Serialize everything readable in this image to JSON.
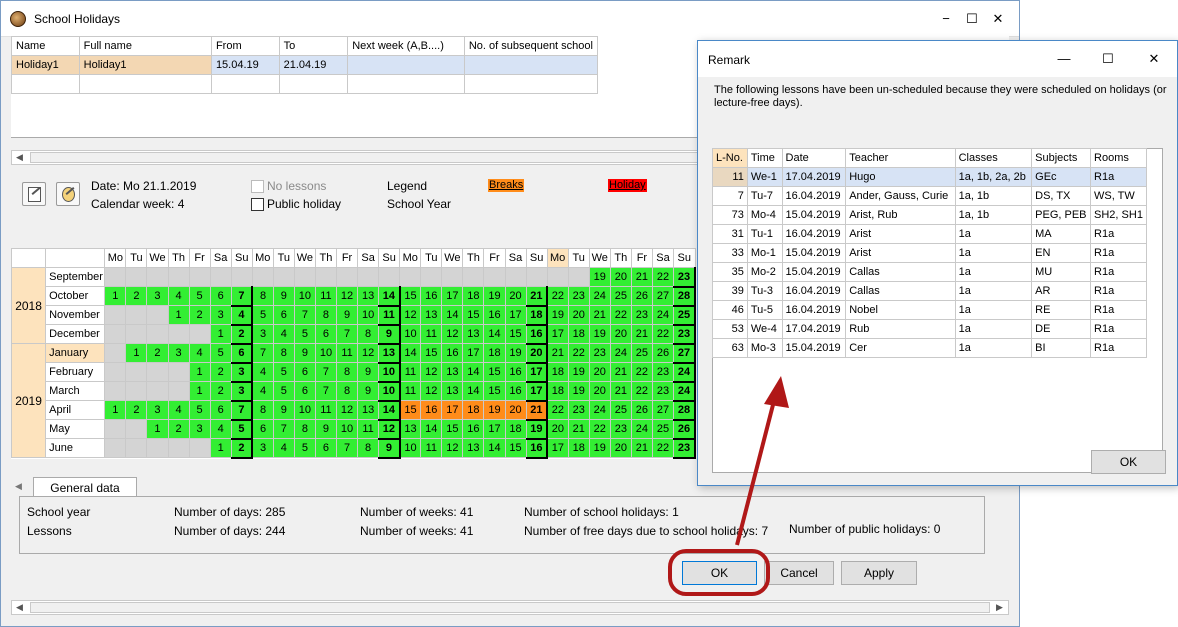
{
  "main_window": {
    "title": "School Holidays",
    "controls": {
      "minimize": "−",
      "maximize": "☐",
      "close": "✕"
    }
  },
  "holidays_grid": {
    "columns": [
      "Name",
      "Full name",
      "From",
      "To",
      "Next week (A,B....)",
      "No. of subsequent school"
    ],
    "rows": [
      [
        "Holiday1",
        "Holiday1",
        "15.04.19",
        "21.04.19",
        "",
        ""
      ],
      [
        "",
        "",
        "",
        "",
        "",
        ""
      ]
    ]
  },
  "info": {
    "date": "Date: Mo 21.1.2019",
    "calendar_week": "Calendar week: 4",
    "no_lessons": "No lessons",
    "public_holiday": "Public holiday",
    "legend": "Legend",
    "school_year": "School Year",
    "breaks": "Breaks",
    "holiday": "Holiday",
    "colors": {
      "breaks": "#ff8c1a",
      "holiday": "#ff0000",
      "school_day": "#33ee33",
      "blank": "#d4d4d4"
    }
  },
  "calendar": {
    "day_headers": [
      "Mo",
      "Tu",
      "We",
      "Th",
      "Fr",
      "Sa",
      "Su",
      "Mo",
      "Tu",
      "We",
      "Th",
      "Fr",
      "Sa",
      "Su",
      "Mo",
      "Tu",
      "We",
      "Th",
      "Fr",
      "Sa",
      "Su",
      "Mo",
      "Tu",
      "We",
      "Th",
      "Fr",
      "Sa",
      "Su"
    ],
    "years": [
      {
        "label": "2018",
        "rows": 4
      },
      {
        "label": "2019",
        "rows": 6
      }
    ],
    "months": [
      {
        "name": "September",
        "days": [
          "",
          "",
          "",
          "",
          "",
          "",
          "",
          "",
          "",
          "",
          "",
          "",
          "",
          "",
          "",
          "",
          "",
          "",
          "",
          "",
          "",
          "",
          "",
          "19",
          "20",
          "21",
          "22",
          "23"
        ]
      },
      {
        "name": "October",
        "days": [
          "1",
          "2",
          "3",
          "4",
          "5",
          "6",
          "7",
          "8",
          "9",
          "10",
          "11",
          "12",
          "13",
          "14",
          "15",
          "16",
          "17",
          "18",
          "19",
          "20",
          "21",
          "22",
          "23",
          "24",
          "25",
          "26",
          "27",
          "28"
        ]
      },
      {
        "name": "November",
        "days": [
          "",
          "",
          "",
          "1",
          "2",
          "3",
          "4",
          "5",
          "6",
          "7",
          "8",
          "9",
          "10",
          "11",
          "12",
          "13",
          "14",
          "15",
          "16",
          "17",
          "18",
          "19",
          "20",
          "21",
          "22",
          "23",
          "24",
          "25"
        ]
      },
      {
        "name": "December",
        "days": [
          "",
          "",
          "",
          "",
          "",
          "1",
          "2",
          "3",
          "4",
          "5",
          "6",
          "7",
          "8",
          "9",
          "10",
          "11",
          "12",
          "13",
          "14",
          "15",
          "16",
          "17",
          "18",
          "19",
          "20",
          "21",
          "22",
          "23"
        ]
      },
      {
        "name": "January",
        "days": [
          "",
          "1",
          "2",
          "3",
          "4",
          "5",
          "6",
          "7",
          "8",
          "9",
          "10",
          "11",
          "12",
          "13",
          "14",
          "15",
          "16",
          "17",
          "18",
          "19",
          "20",
          "21",
          "22",
          "23",
          "24",
          "25",
          "26",
          "27"
        ]
      },
      {
        "name": "February",
        "days": [
          "",
          "",
          "",
          "",
          "1",
          "2",
          "3",
          "4",
          "5",
          "6",
          "7",
          "8",
          "9",
          "10",
          "11",
          "12",
          "13",
          "14",
          "15",
          "16",
          "17",
          "18",
          "19",
          "20",
          "21",
          "22",
          "23",
          "24"
        ]
      },
      {
        "name": "March",
        "days": [
          "",
          "",
          "",
          "",
          "1",
          "2",
          "3",
          "4",
          "5",
          "6",
          "7",
          "8",
          "9",
          "10",
          "11",
          "12",
          "13",
          "14",
          "15",
          "16",
          "17",
          "18",
          "19",
          "20",
          "21",
          "22",
          "23",
          "24"
        ]
      },
      {
        "name": "April",
        "days": [
          "1",
          "2",
          "3",
          "4",
          "5",
          "6",
          "7",
          "8",
          "9",
          "10",
          "11",
          "12",
          "13",
          "14",
          "15",
          "16",
          "17",
          "18",
          "19",
          "20",
          "21",
          "22",
          "23",
          "24",
          "25",
          "26",
          "27",
          "28"
        ]
      },
      {
        "name": "May",
        "days": [
          "",
          "",
          "1",
          "2",
          "3",
          "4",
          "5",
          "6",
          "7",
          "8",
          "9",
          "10",
          "11",
          "12",
          "13",
          "14",
          "15",
          "16",
          "17",
          "18",
          "19",
          "20",
          "21",
          "22",
          "23",
          "24",
          "25",
          "26"
        ]
      },
      {
        "name": "June",
        "days": [
          "",
          "",
          "",
          "",
          "",
          "1",
          "2",
          "3",
          "4",
          "5",
          "6",
          "7",
          "8",
          "9",
          "10",
          "11",
          "12",
          "13",
          "14",
          "15",
          "16",
          "17",
          "18",
          "19",
          "20",
          "21",
          "22",
          "23"
        ]
      }
    ],
    "holiday_days": {
      "April": [
        "15",
        "16",
        "17",
        "18",
        "19",
        "20",
        "21"
      ]
    },
    "current_month": "January"
  },
  "general": {
    "tab_label": "General data",
    "school_year_label": "School year",
    "lessons_label": "Lessons",
    "sy_days": "Number of days: 285",
    "sy_weeks": "Number of weeks: 41",
    "sy_holidays": "Number of school holidays: 1",
    "l_days": "Number of days: 244",
    "l_weeks": "Number of weeks: 41",
    "l_free": "Number of free days due to school holidays: 7",
    "l_public": "Number of public holidays: 0"
  },
  "buttons": {
    "ok": "OK",
    "cancel": "Cancel",
    "apply": "Apply"
  },
  "remark": {
    "title": "Remark",
    "message": "The following lessons have been un-scheduled because they were scheduled on holidays (or lecture-free days).",
    "columns": [
      "L-No.",
      "Time",
      "Date",
      "Teacher",
      "Classes",
      "Subjects",
      "Rooms"
    ],
    "rows": [
      [
        "11",
        "We-1",
        "17.04.2019",
        "Hugo",
        "1a, 1b, 2a, 2b",
        "GEc",
        "R1a"
      ],
      [
        "7",
        "Tu-7",
        "16.04.2019",
        "Ander, Gauss, Curie",
        "1a, 1b",
        "DS, TX",
        "WS, TW"
      ],
      [
        "73",
        "Mo-4",
        "15.04.2019",
        "Arist, Rub",
        "1a, 1b",
        "PEG, PEB",
        "SH2, SH1"
      ],
      [
        "31",
        "Tu-1",
        "16.04.2019",
        "Arist",
        "1a",
        "MA",
        "R1a"
      ],
      [
        "33",
        "Mo-1",
        "15.04.2019",
        "Arist",
        "1a",
        "EN",
        "R1a"
      ],
      [
        "35",
        "Mo-2",
        "15.04.2019",
        "Callas",
        "1a",
        "MU",
        "R1a"
      ],
      [
        "39",
        "Tu-3",
        "16.04.2019",
        "Callas",
        "1a",
        "AR",
        "R1a"
      ],
      [
        "46",
        "Tu-5",
        "16.04.2019",
        "Nobel",
        "1a",
        "RE",
        "R1a"
      ],
      [
        "53",
        "We-4",
        "17.04.2019",
        "Rub",
        "1a",
        "DE",
        "R1a"
      ],
      [
        "63",
        "Mo-3",
        "15.04.2019",
        "Cer",
        "1a",
        "BI",
        "R1a"
      ]
    ],
    "ok": "OK",
    "controls": {
      "minimize": "—",
      "maximize": "☐",
      "close": "✕"
    }
  },
  "annotation_color": "#b01818"
}
